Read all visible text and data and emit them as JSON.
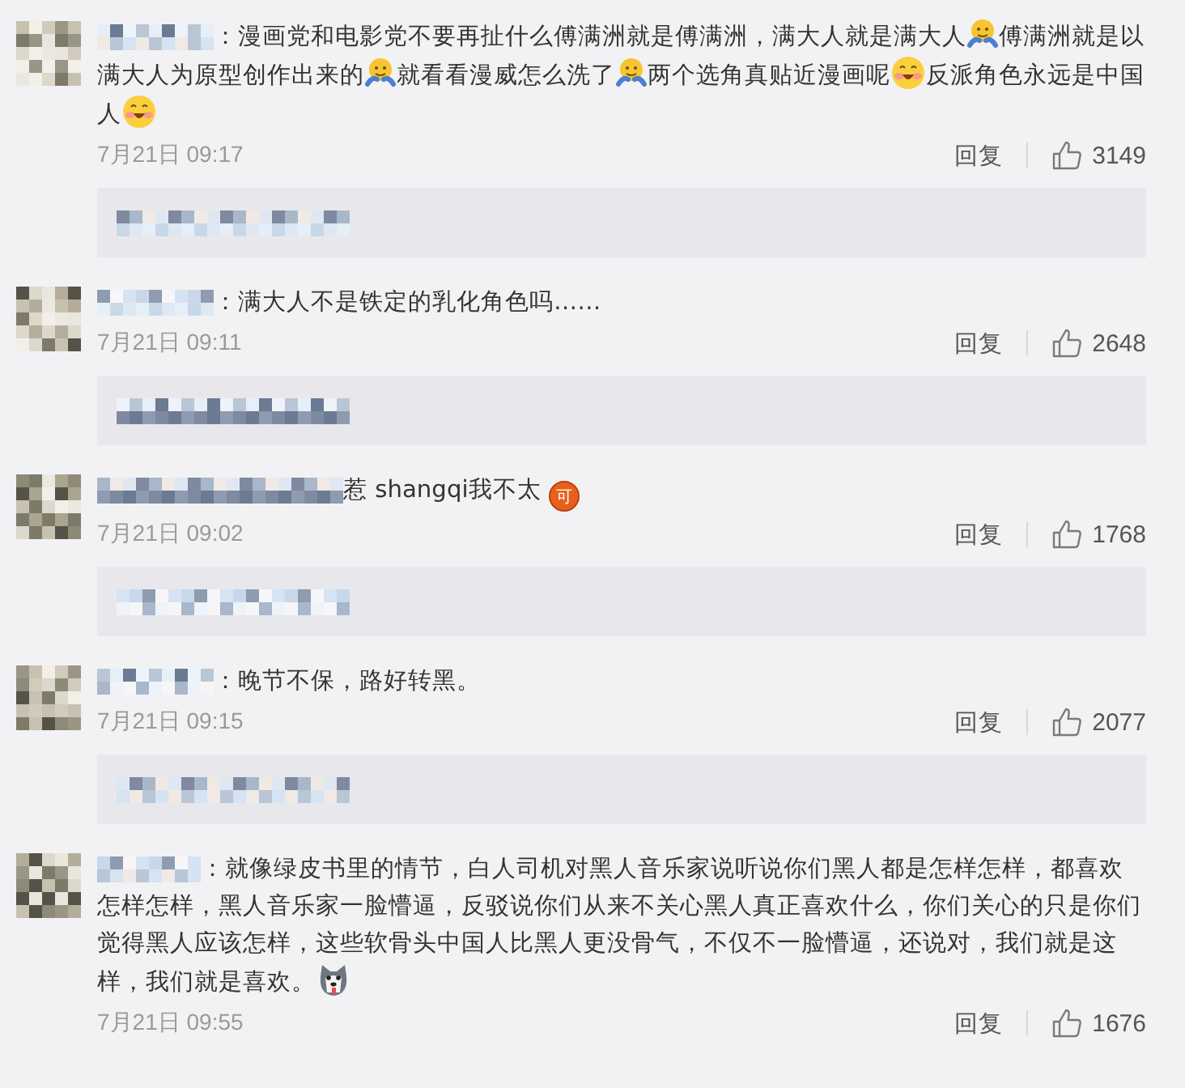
{
  "comments": [
    {
      "segments": [
        {
          "kind": "text",
          "text": "：漫画党和电影党不要再扯什么傅满洲就是傅满洲，满大人就是满大人"
        },
        {
          "kind": "hug"
        },
        {
          "kind": "text",
          "text": "傅满洲就是以满大人为原型创作出来的"
        },
        {
          "kind": "hug"
        },
        {
          "kind": "text",
          "text": "就看看漫威怎么洗了"
        },
        {
          "kind": "hug"
        },
        {
          "kind": "text",
          "text": "两个选角真贴近漫画呢"
        },
        {
          "kind": "grin"
        },
        {
          "kind": "text",
          "text": "反派角色永远是中国人"
        },
        {
          "kind": "grin"
        }
      ],
      "date": "7月21日 09:17",
      "reply": "回复",
      "likes": "3149"
    },
    {
      "segments": [
        {
          "kind": "text",
          "text": "：满大人不是铁定的乳化角色吗……"
        }
      ],
      "date": "7月21日 09:11",
      "reply": "回复",
      "likes": "2648"
    },
    {
      "segments": [
        {
          "kind": "text",
          "text": "惹 shangqi我不太"
        },
        {
          "kind": "badge",
          "text": "可"
        }
      ],
      "date": "7月21日 09:02",
      "reply": "回复",
      "likes": "1768"
    },
    {
      "segments": [
        {
          "kind": "text",
          "text": "：晚节不保，路好转黑。"
        }
      ],
      "date": "7月21日 09:15",
      "reply": "回复",
      "likes": "2077"
    },
    {
      "segments": [
        {
          "kind": "text",
          "text": "：就像绿皮书里的情节，白人司机对黑人音乐家说听说你们黑人都是怎样怎样，都喜欢怎样怎样，黑人音乐家一脸懵逼，反驳说你们从来不关心黑人真正喜欢什么，你们关心的只是你们觉得黑人应该怎样，这些软骨头中国人比黑人更没骨气，不仅不一脸懵逼，还说对，我们就是这样，我们就是喜欢。"
        },
        {
          "kind": "husky"
        }
      ],
      "date": "7月21日 09:55",
      "reply": "回复",
      "likes": "1676"
    }
  ]
}
